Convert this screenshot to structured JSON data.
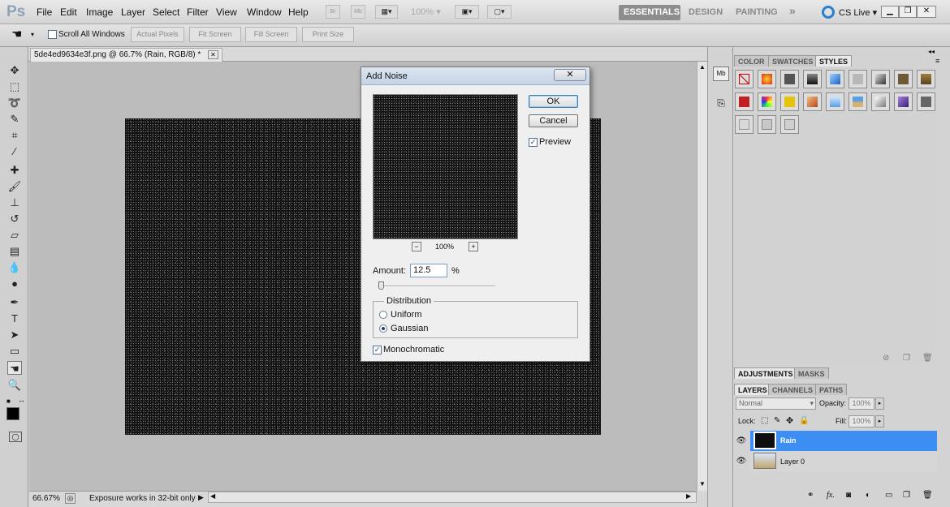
{
  "app": {
    "logo": "Ps"
  },
  "menu": [
    "File",
    "Edit",
    "Image",
    "Layer",
    "Select",
    "Filter",
    "View",
    "Window",
    "Help"
  ],
  "menubar": {
    "bridge_icon": "Br",
    "minibridge_icon": "Mb",
    "zoom": "100%",
    "workspaces": [
      "ESSENTIALS",
      "DESIGN",
      "PAINTING"
    ],
    "more": "»",
    "cs_live": "CS Live"
  },
  "options": {
    "scroll_all": "Scroll All Windows",
    "actual_pixels": "Actual Pixels",
    "fit_screen": "Fit Screen",
    "fill_screen": "Fill Screen",
    "print_size": "Print Size"
  },
  "document": {
    "tab_title": "5de4ed9634e3f.png @ 66.7% (Rain, RGB/8) *",
    "close": "✕"
  },
  "status": {
    "zoom": "66.67%",
    "message": "Exposure works in 32-bit only"
  },
  "dialog": {
    "title": "Add Noise",
    "close": "✕",
    "ok": "OK",
    "cancel": "Cancel",
    "preview_label": "Preview",
    "preview_checked": true,
    "zoom_minus": "−",
    "zoom_plus": "+",
    "zoom_value": "100%",
    "amount_label": "Amount:",
    "amount_value": "12.5",
    "amount_unit": "%",
    "amount_slider": 0.03,
    "distribution_label": "Distribution",
    "uniform": "Uniform",
    "gaussian": "Gaussian",
    "selected_distribution": "Gaussian",
    "monochromatic": "Monochromatic",
    "monochromatic_checked": true
  },
  "panels": {
    "top_tabs": [
      "COLOR",
      "SWATCHES",
      "STYLES"
    ],
    "active_top_tab": "STYLES",
    "adjust_tabs": [
      "ADJUSTMENTS",
      "MASKS"
    ],
    "layer_tabs": [
      "LAYERS",
      "CHANNELS",
      "PATHS"
    ],
    "blend_mode": "Normal",
    "opacity_label": "Opacity:",
    "opacity_value": "100%",
    "lock_label": "Lock:",
    "fill_label": "Fill:",
    "fill_value": "100%",
    "layers": [
      {
        "name": "Rain",
        "selected": true
      },
      {
        "name": "Layer 0",
        "selected": false
      }
    ]
  },
  "colors": {
    "selected_layer": "#3c8ef3",
    "dialog_title_grad": "#c4d3e6",
    "canvas": "#121212"
  }
}
